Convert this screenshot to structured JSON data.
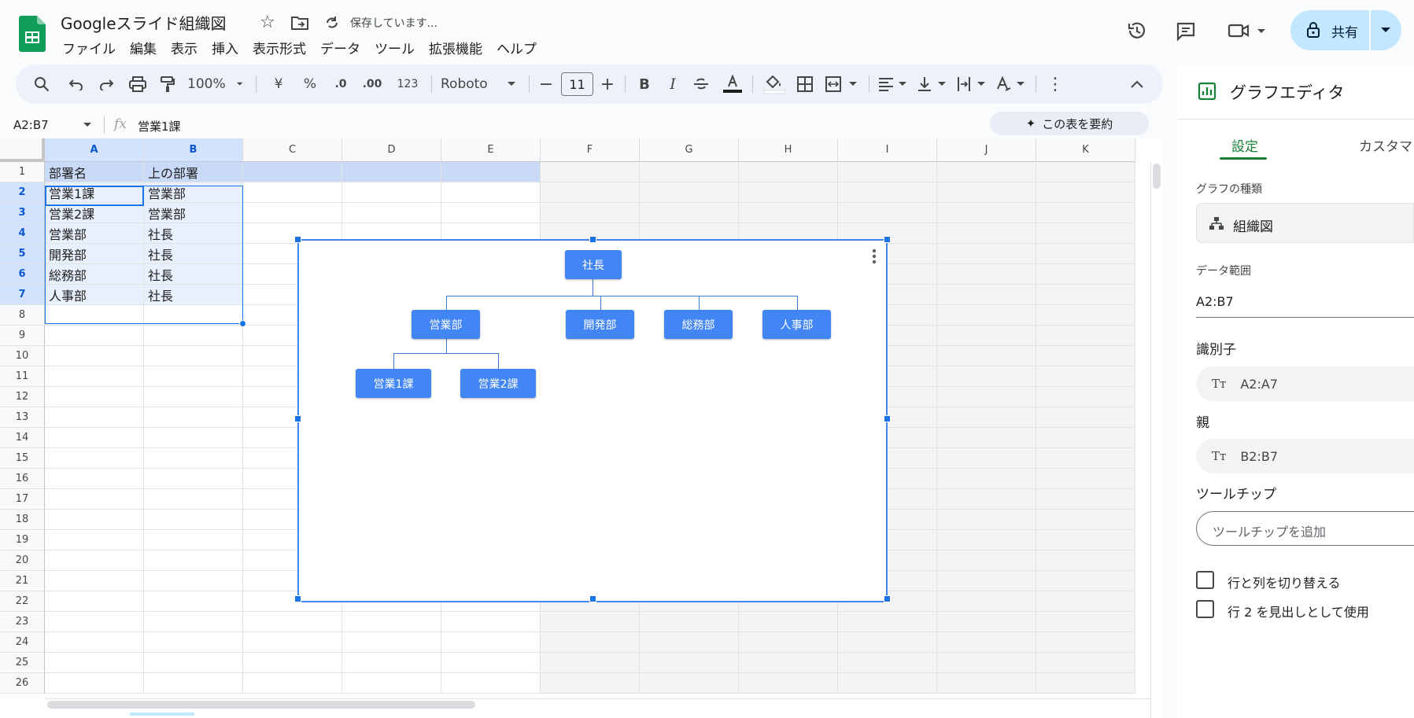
{
  "header": {
    "doc_title": "Googleスライド組織図",
    "save_status": "保存しています...",
    "menu": [
      "ファイル",
      "編集",
      "表示",
      "挿入",
      "表示形式",
      "データ",
      "ツール",
      "拡張機能",
      "ヘルプ"
    ],
    "share_label": "共有"
  },
  "toolbar": {
    "zoom": "100%",
    "currency": "¥",
    "percent": "%",
    "dec_decrease": ".0",
    "dec_increase": ".00",
    "num_format": "123",
    "font": "Roboto",
    "font_size": "11",
    "bold": "B",
    "italic": "I"
  },
  "formula_bar": {
    "name_box": "A2:B7",
    "fx": "fx",
    "value": "営業1課",
    "summarize": "この表を要約"
  },
  "grid": {
    "columns": [
      "A",
      "B",
      "C",
      "D",
      "E",
      "F",
      "G",
      "H",
      "I",
      "J",
      "K"
    ],
    "rows": [
      "1",
      "2",
      "3",
      "4",
      "5",
      "6",
      "7",
      "8",
      "9",
      "10",
      "11",
      "12",
      "13",
      "14",
      "15",
      "16",
      "17",
      "18",
      "19",
      "20",
      "21",
      "22",
      "23",
      "24",
      "25",
      "26"
    ],
    "cells": [
      [
        "部署名",
        "上の部署"
      ],
      [
        "営業1課",
        "営業部"
      ],
      [
        "営業2課",
        "営業部"
      ],
      [
        "営業部",
        "社長"
      ],
      [
        "開発部",
        "社長"
      ],
      [
        "総務部",
        "社長"
      ],
      [
        "人事部",
        "社長"
      ]
    ]
  },
  "chart": {
    "nodes": {
      "president": "社長",
      "sales": "営業部",
      "dev": "開発部",
      "general": "総務部",
      "hr": "人事部",
      "sales1": "営業1課",
      "sales2": "営業2課"
    }
  },
  "chart_data": {
    "type": "table",
    "chart_kind": "org-chart",
    "nodes": [
      {
        "id": "社長",
        "parent": null
      },
      {
        "id": "営業部",
        "parent": "社長"
      },
      {
        "id": "開発部",
        "parent": "社長"
      },
      {
        "id": "総務部",
        "parent": "社長"
      },
      {
        "id": "人事部",
        "parent": "社長"
      },
      {
        "id": "営業1課",
        "parent": "営業部"
      },
      {
        "id": "営業2課",
        "parent": "営業部"
      }
    ]
  },
  "panel": {
    "title": "グラフエディタ",
    "tab_setup": "設定",
    "tab_customize": "カスタマ",
    "chart_type_label": "グラフの種類",
    "chart_type_value": "組織図",
    "data_range_label": "データ範囲",
    "data_range_value": "A2:B7",
    "id_label": "識別子",
    "id_value": "A2:A7",
    "parent_label": "親",
    "parent_value": "B2:B7",
    "tooltip_label": "ツールチップ",
    "tooltip_placeholder": "ツールチップを追加",
    "switch_rows_cols": "行と列を切り替える",
    "use_row_header": "行 2 を見出しとして使用"
  },
  "colors": {
    "accent": "#1a73e8",
    "node": "#4285f4",
    "share_bg": "#c2e7ff",
    "sheets_green": "#0f9d58"
  }
}
